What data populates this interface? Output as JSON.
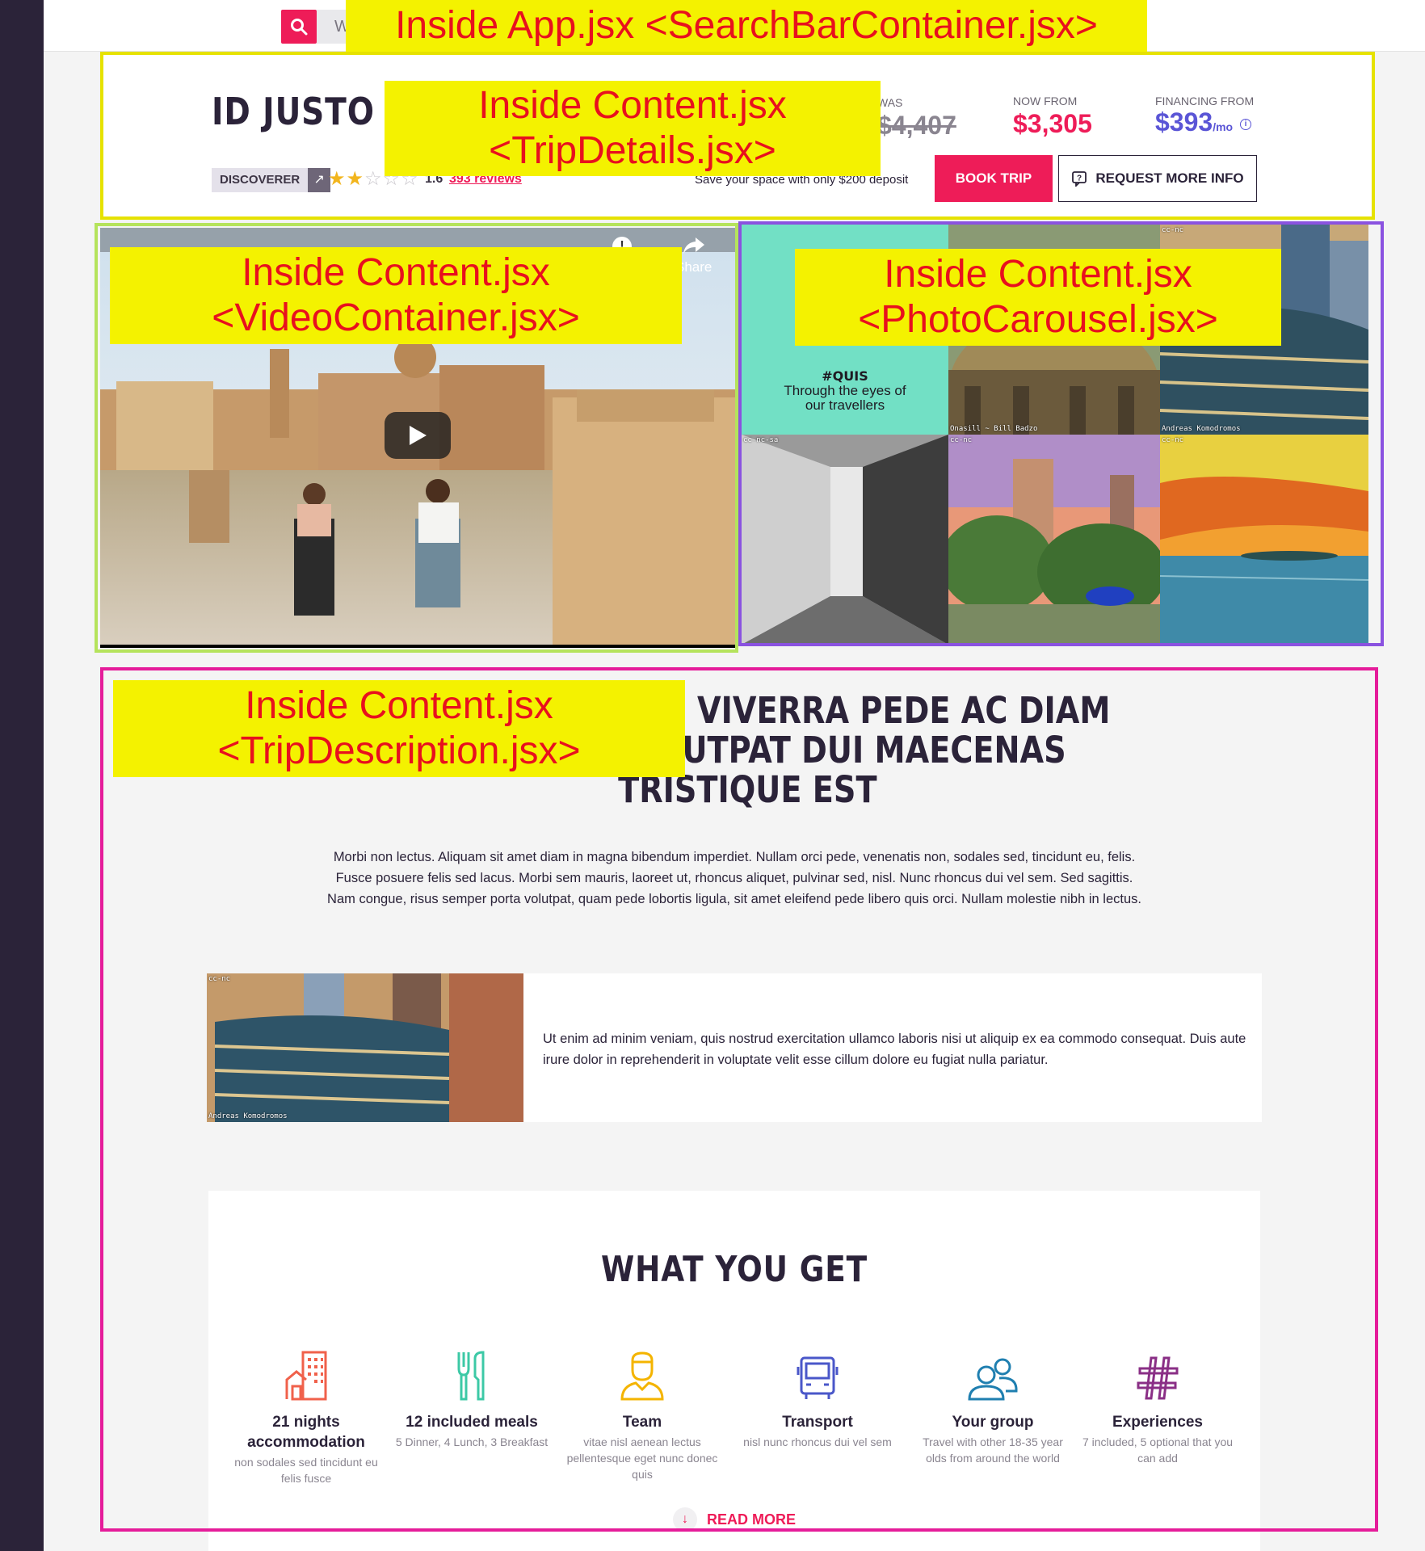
{
  "colors": {
    "accent": "#ee1c58",
    "financing": "#5a55d6",
    "rail": "#2b2339",
    "annotation_fill": "#f4f200",
    "annotation_text": "#e8101e",
    "frame_search": "#e6e200",
    "frame_trip_details": "#e6e200",
    "frame_video": "#b5e35c",
    "frame_carousel": "#8a52e0",
    "frame_description": "#e51c9a"
  },
  "annotations": {
    "search_bar": "Inside App.jsx <SearchBarContainer.jsx>",
    "trip_details_line1": "Inside Content.jsx",
    "trip_details_line2": "<TripDetails.jsx>",
    "video_line1": "Inside Content.jsx",
    "video_line2": "<VideoContainer.jsx>",
    "carousel_line1": "Inside Content.jsx",
    "carousel_line2": "<PhotoCarousel.jsx>",
    "description_line1": "Inside Content.jsx",
    "description_line2": "<TripDescription.jsx>"
  },
  "search": {
    "icon": "search-icon",
    "field_text": "W"
  },
  "trip": {
    "title": "ID JUSTO S",
    "badge": "DISCOVERER",
    "badge_icon": "arrow-up-right-icon",
    "stars_filled": 2,
    "stars_total": 5,
    "rating": "1.6",
    "reviews": "393 reviews",
    "was_label": "WAS",
    "was_price": "$4,407",
    "now_label": "NOW FROM",
    "now_price": "$3,305",
    "financing_label": "FINANCING FROM",
    "financing_price": "$393",
    "financing_unit": "/mo",
    "deposit_note": "Save your space with only $200 deposit",
    "book_button": "BOOK TRIP",
    "info_button": "REQUEST MORE INFO"
  },
  "video": {
    "share_label": "Share",
    "play_icon": "play-icon",
    "share_icon": "share-icon",
    "info_icon": "info-icon"
  },
  "carousel": {
    "promo_tag": "#QUIS",
    "promo_text_line1": "Through the eyes of",
    "promo_text_line2": "our travellers",
    "credits": {
      "t2": "Onasill ~ Bill Badzo",
      "t3": "Andreas Komodromos",
      "license": "cc-nc",
      "license2": "cc-nc-sa"
    }
  },
  "description": {
    "heading_line1": "QUE VIVERRA PEDE AC DIAM",
    "heading_line2": "VOLUTPAT DUI MAECENAS",
    "heading_line3": "TRISTIQUE EST",
    "body": "Morbi non lectus. Aliquam sit amet diam in magna bibendum imperdiet. Nullam orci pede, venenatis non, sodales sed, tincidunt eu, felis. Fusce posuere felis sed lacus. Morbi sem mauris, laoreet ut, rhoncus aliquet, pulvinar sed, nisl. Nunc rhoncus dui vel sem. Sed sagittis. Nam congue, risus semper porta volutpat, quam pede lobortis ligula, sit amet eleifend pede libero quis orci. Nullam molestie nibh in lectus.",
    "feature_credit": "Andreas Komodromos",
    "feature_license": "cc-nc",
    "feature_text": "Ut enim ad minim veniam, quis nostrud exercitation ullamco laboris nisi ut aliquip ex ea commodo consequat. Duis aute irure dolor in reprehenderit in voluptate velit esse cillum dolore eu fugiat nulla pariatur."
  },
  "what_you_get": {
    "title": "WHAT YOU GET",
    "items": [
      {
        "icon": "building-icon",
        "name": "21 nights accommodation",
        "sub": "non sodales sed tincidunt eu felis fusce",
        "color": "#f0614b"
      },
      {
        "icon": "cutlery-icon",
        "name": "12 included meals",
        "sub": "5 Dinner, 4 Lunch, 3 Breakfast",
        "color": "#3cc9a6"
      },
      {
        "icon": "person-icon",
        "name": "Team",
        "sub": "vitae nisl aenean lectus pellentesque eget nunc donec quis",
        "color": "#f4b400"
      },
      {
        "icon": "bus-icon",
        "name": "Transport",
        "sub": "nisl nunc rhoncus dui vel sem",
        "color": "#4a57c9"
      },
      {
        "icon": "group-icon",
        "name": "Your group",
        "sub": "Travel with other 18-35 year olds from around the world",
        "color": "#1f7fb0"
      },
      {
        "icon": "hashtag-icon",
        "name": "Experiences",
        "sub": "7 included, 5 optional that you can add",
        "color": "#8a2f86"
      }
    ],
    "read_more": "READ MORE",
    "read_more_icon": "arrow-down-icon"
  }
}
